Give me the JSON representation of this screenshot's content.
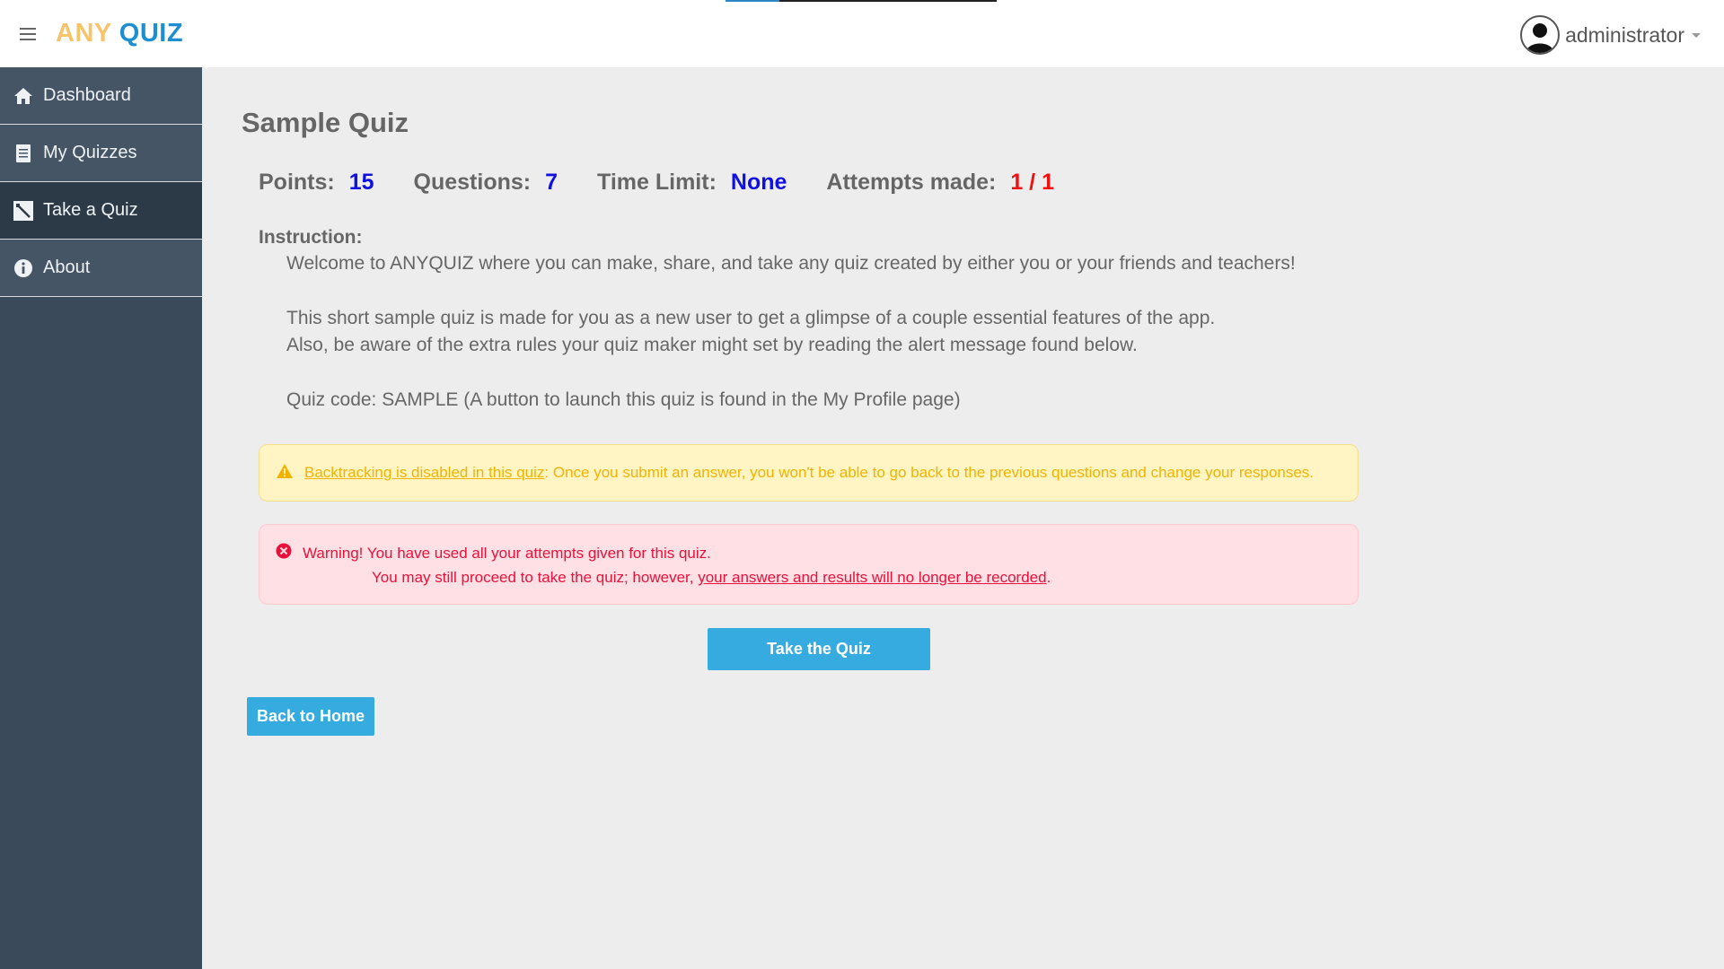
{
  "header": {
    "brand_any": "ANY",
    "brand_quiz": "QUIZ",
    "user_name": "administrator",
    "icons": [
      "hamburger-icon",
      "avatar",
      "caret-down-icon"
    ]
  },
  "sidebar": {
    "items": [
      {
        "label": "Dashboard",
        "icon": "home-icon"
      },
      {
        "label": "My Quizzes",
        "icon": "document-icon"
      },
      {
        "label": "Take a Quiz",
        "icon": "quiz-icon",
        "active": true
      },
      {
        "label": "About",
        "icon": "info-icon"
      }
    ]
  },
  "main": {
    "title": "Sample Quiz",
    "stats": {
      "points_label": "Points:",
      "points_value": "15",
      "questions_label": "Questions:",
      "questions_value": "7",
      "time_label": "Time Limit:",
      "time_value": "None",
      "attempts_label": "Attempts made:",
      "attempts_value": "1 / 1"
    },
    "instruction_label": "Instruction:",
    "instruction_lines": [
      "Welcome to ANYQUIZ where you can make, share, and take any quiz created by either you or your friends and teachers!",
      "This short sample quiz is made for you as a new user to get a glimpse of a couple essential features of the app.",
      "Also, be aware of the extra rules your quiz maker might set by reading the alert message found below.",
      "Quiz code: SAMPLE (A button to launch this quiz is found in the My Profile page)"
    ],
    "warning_alert": {
      "link_text": "Backtracking is disabled in this quiz",
      "text": ": Once you submit an answer, you won't be able to go back to the previous questions and change your responses."
    },
    "danger_alert": {
      "line1": "Warning! You have used all your attempts given for this quiz.",
      "line2_prefix": "You may still proceed to take the quiz; however, ",
      "line2_link": "your answers and results will no longer be recorded",
      "line2_suffix": "."
    },
    "take_button": "Take the Quiz",
    "back_button": "Back to Home"
  },
  "colors": {
    "accent": "#35abdf",
    "sidebar_bg": "#3a4a5a",
    "stat_value": "#1010e0",
    "attempts_value": "#ee1111",
    "warning_text": "#f0b300",
    "danger_text": "#e8113a"
  }
}
